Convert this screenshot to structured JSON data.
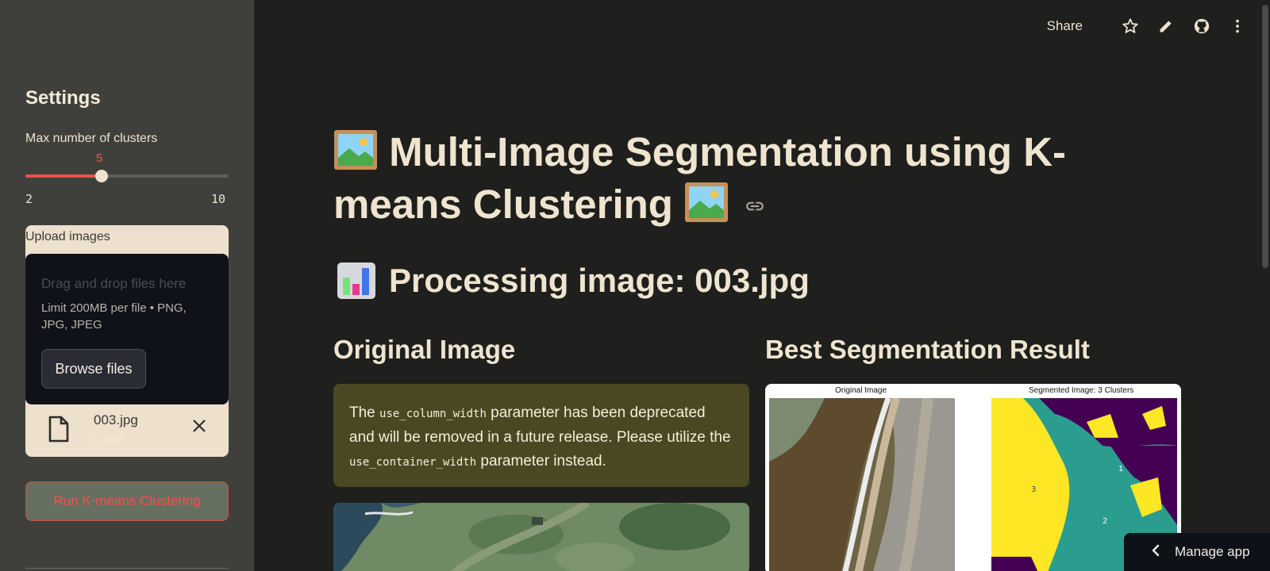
{
  "colors": {
    "accent": "#ff4b4b",
    "sidebar_bg": "#3f403b",
    "main_bg": "#1f201d",
    "warning_bg": "#4b4722"
  },
  "sidebar": {
    "title": "Settings",
    "slider": {
      "label": "Max number of clusters",
      "value": "5",
      "min": "2",
      "max": "10",
      "fraction": 0.375
    },
    "uploader": {
      "label": "Upload images",
      "drop_text": "Drag and drop files here",
      "limit_text": "Limit 200MB per file • PNG, JPG, JPEG",
      "browse_label": "Browse files",
      "file": {
        "name": "003.jpg",
        "size": "8.3KB"
      }
    },
    "run_button": "Run K-means Clustering"
  },
  "toolbar": {
    "share": "Share",
    "icons": [
      "star-icon",
      "pencil-icon",
      "github-icon",
      "more-vertical-icon"
    ]
  },
  "main": {
    "title_part1": "Multi-Image Segmentation using K-means Clustering",
    "processing": "Processing image: 003.jpg",
    "col_left_title": "Original Image",
    "col_right_title": "Best Segmentation Result",
    "warning": {
      "pre": "The ",
      "code1": "use_column_width",
      "mid": " parameter has been deprecated and will be removed in a future release. Please utilize the ",
      "code2": "use_container_width",
      "post": " parameter instead."
    },
    "figure": {
      "left_caption": "Original Image",
      "right_caption": "Segmented Image: 3 Clusters",
      "cluster_labels": [
        "1",
        "2",
        "3"
      ]
    }
  },
  "manage_app": "Manage app"
}
